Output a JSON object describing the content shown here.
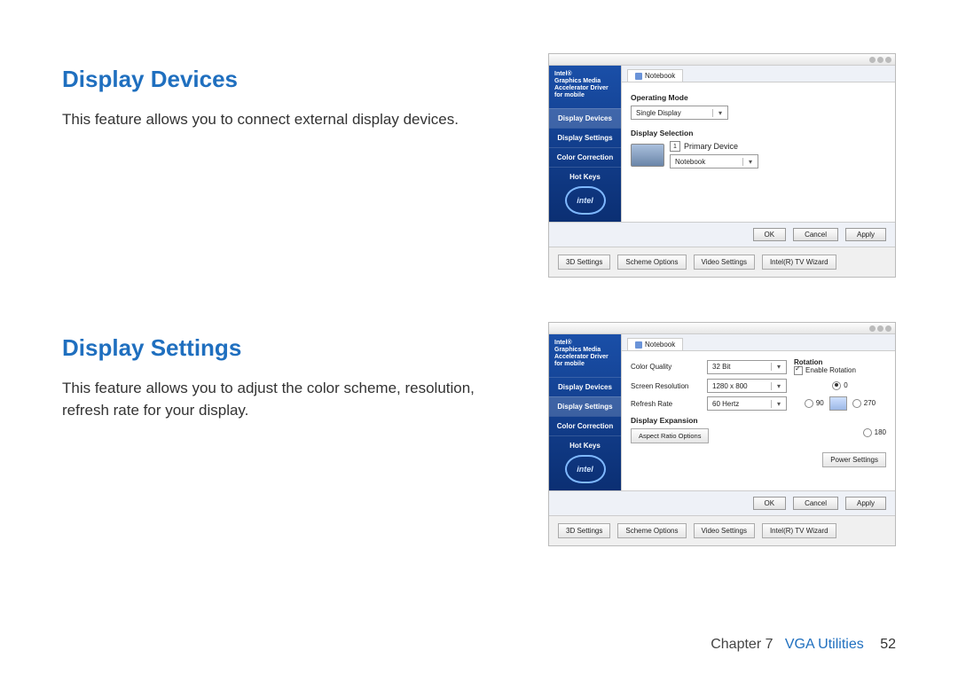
{
  "sections": {
    "devices": {
      "title": "Display Devices",
      "body": "This feature allows you to connect external display devices."
    },
    "settings": {
      "title": "Display Settings",
      "body": "This feature allows you to adjust the color scheme, resolution, refresh rate for your display."
    }
  },
  "panel": {
    "brand_line1": "Intel®",
    "brand_line2": "Graphics Media",
    "brand_line3": "Accelerator Driver",
    "brand_line4": "for mobile",
    "logo_text": "intel",
    "sidebar": {
      "devices": "Display Devices",
      "settings": "Display Settings",
      "color": "Color Correction",
      "hotkeys": "Hot Keys"
    },
    "tab_label": "Notebook",
    "devices_content": {
      "op_mode_label": "Operating Mode",
      "op_mode_value": "Single Display",
      "selection_label": "Display Selection",
      "primary_badge": "1",
      "primary_label": "Primary Device",
      "device_value": "Notebook"
    },
    "settings_content": {
      "color_quality_label": "Color Quality",
      "color_quality_value": "32 Bit",
      "resolution_label": "Screen Resolution",
      "resolution_value": "1280 x 800",
      "refresh_label": "Refresh Rate",
      "refresh_value": "60 Hertz",
      "rotation_label": "Rotation",
      "enable_rotation": "Enable Rotation",
      "rot_0": "0",
      "rot_90": "90",
      "rot_180": "180",
      "rot_270": "270",
      "expansion_label": "Display Expansion",
      "aspect_btn": "Aspect Ratio Options",
      "power_btn": "Power Settings"
    },
    "actions": {
      "ok": "OK",
      "cancel": "Cancel",
      "apply": "Apply"
    },
    "footer": {
      "f1": "3D Settings",
      "f2": "Scheme Options",
      "f3": "Video Settings",
      "f4": "Intel(R) TV Wizard"
    }
  },
  "footer": {
    "chapter": "Chapter 7",
    "title": "VGA Utilities",
    "page": "52"
  }
}
